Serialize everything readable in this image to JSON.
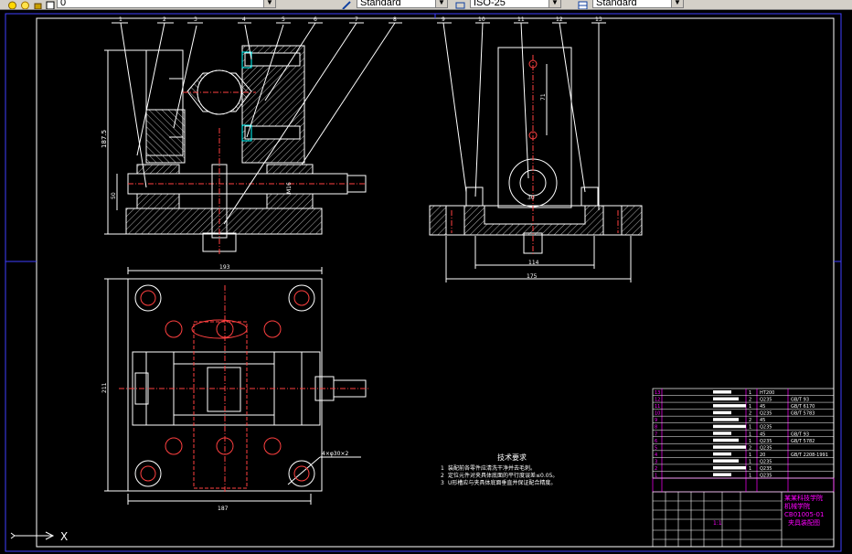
{
  "toolbar": {
    "layer_value": "0",
    "text_style": "Standard",
    "dim_style": "ISO-25",
    "table_style": "Standard"
  },
  "dims": {
    "front_height": "187.5",
    "front_small": "50",
    "front_thread": "M16",
    "side_top": "71",
    "side_center": "30",
    "side_span_inner": "114",
    "side_span_outer": "175",
    "plan_width": "193",
    "plan_height": "211",
    "plan_bottom": "187",
    "plan_hole_note": "4×φ30×2"
  },
  "part_numbers": [
    "1",
    "2",
    "3",
    "4",
    "5",
    "6",
    "7",
    "8",
    "9",
    "10",
    "11",
    "12",
    "13"
  ],
  "tech_req": {
    "title": "技术要求",
    "items": [
      {
        "num": "1",
        "text": "装配前各零件应清洗干净并去毛刺。"
      },
      {
        "num": "2",
        "text": "定位元件对夹具体底面的平行度误差≤0.05。"
      },
      {
        "num": "3",
        "text": "U形槽应与夹具体底面垂直并保证配合精度。"
      }
    ]
  },
  "title_block": {
    "school": "某某科技学院",
    "sub": "机械学院",
    "code": "CB01005-01",
    "name": "夹具装配图",
    "scale": "1:1"
  },
  "bom_rows": [
    {
      "no": "13",
      "qty": "1",
      "mat": "HT200",
      "std": ""
    },
    {
      "no": "12",
      "qty": "2",
      "mat": "Q235",
      "std": "GB/T 93"
    },
    {
      "no": "11",
      "qty": "1",
      "mat": "45",
      "std": "GB/T 6170"
    },
    {
      "no": "10",
      "qty": "2",
      "mat": "Q235",
      "std": "GB/T 5783"
    },
    {
      "no": "9",
      "qty": "2",
      "mat": "45",
      "std": ""
    },
    {
      "no": "8",
      "qty": "1",
      "mat": "Q235",
      "std": ""
    },
    {
      "no": "7",
      "qty": "1",
      "mat": "45",
      "std": "GB/T 93"
    },
    {
      "no": "6",
      "qty": "1",
      "mat": "Q235",
      "std": "GB/T 5782"
    },
    {
      "no": "5",
      "qty": "2",
      "mat": "Q235",
      "std": ""
    },
    {
      "no": "4",
      "qty": "1",
      "mat": "20",
      "std": "GB/T 2208-1991"
    },
    {
      "no": "3",
      "qty": "1",
      "mat": "Q235",
      "std": ""
    },
    {
      "no": "2",
      "qty": "1",
      "mat": "Q235",
      "std": ""
    },
    {
      "no": "1",
      "qty": "1",
      "mat": "Q235",
      "std": ""
    }
  ],
  "ucs_label": "X"
}
